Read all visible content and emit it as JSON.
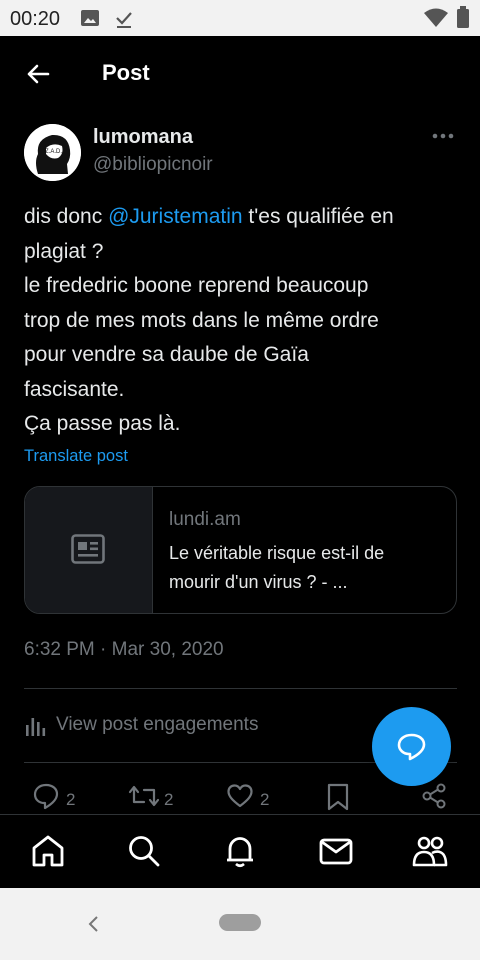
{
  "status_bar": {
    "time": "00:20"
  },
  "header": {
    "title": "Post"
  },
  "post": {
    "author_name": "lumomana",
    "author_handle": "@bibliopicnoir",
    "avatar_text": "Z.A.D.",
    "text_line1_before": "dis donc ",
    "mention": "@Juristematin",
    "text_line1_after": " t'es qualifiée en",
    "text_lines": [
      "plagiat ?",
      "le frededric boone reprend beaucoup",
      "trop de mes mots dans le même ordre",
      "pour vendre sa daube de Gaïa",
      "fascisante.",
      "Ça passe pas là."
    ],
    "translate_label": "Translate post",
    "link_card": {
      "domain": "lundi.am",
      "title": "Le véritable risque est-il de mourir d'un virus ? - ..."
    },
    "timestamp": "6:32 PM · Mar 30, 2020",
    "engagements_label": "View post engagements",
    "reply_count": "2",
    "repost_count": "2",
    "like_count": "2"
  },
  "colors": {
    "accent": "#1d9bf0",
    "background": "#000000",
    "muted": "#71767b",
    "divider": "#2f3336"
  },
  "icons": [
    "back-arrow-icon",
    "more-icon",
    "article-icon",
    "analytics-icon",
    "reply-icon",
    "repost-icon",
    "like-icon",
    "bookmark-icon",
    "share-icon",
    "compose-reply-icon",
    "home-icon",
    "search-icon",
    "notifications-icon",
    "messages-icon",
    "communities-icon"
  ]
}
